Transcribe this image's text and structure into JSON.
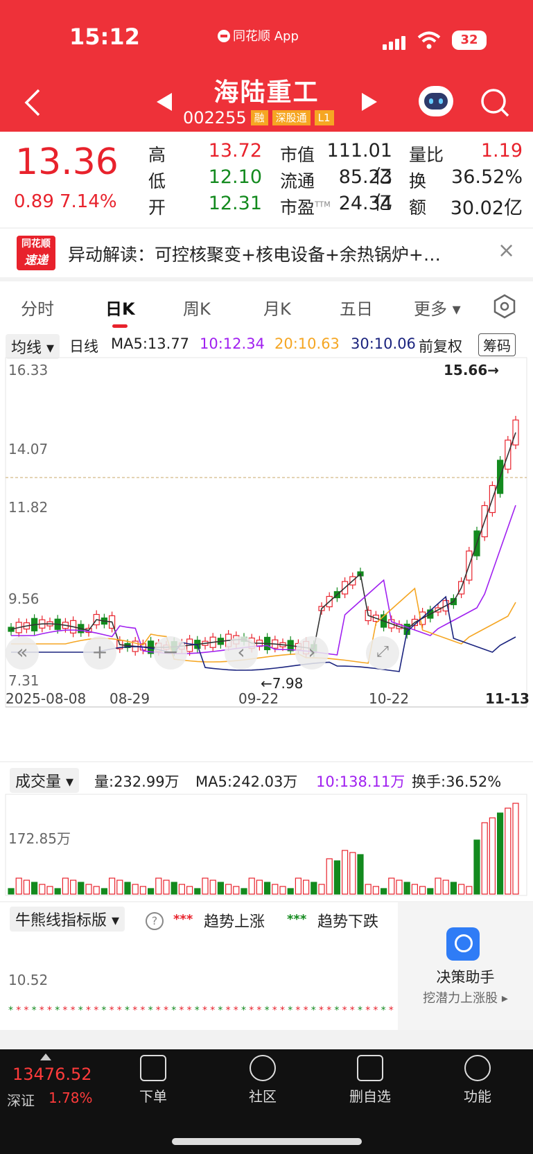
{
  "status": {
    "time": "15:12",
    "app_name": "同花顺 App",
    "battery": "32"
  },
  "header": {
    "title": "海陆重工",
    "code": "002255",
    "tags": [
      "融",
      "深股通",
      "L1"
    ]
  },
  "quote": {
    "price": "13.36",
    "change": "0.89",
    "change_pct": "7.14%",
    "high_label": "高",
    "high": "13.72",
    "low_label": "低",
    "low": "12.10",
    "open_label": "开",
    "open": "12.31",
    "mcap_label": "市值",
    "mcap": "111.01亿",
    "float_label": "流通",
    "float": "85.23亿",
    "pe_label": "市盈",
    "pe_sup": "TTM",
    "pe": "24.34",
    "vr_label": "量比",
    "vr": "1.19",
    "turn_label": "换",
    "turn": "36.52%",
    "amt_label": "额",
    "amt": "30.02亿"
  },
  "banner": {
    "logo_top": "同花顺",
    "logo_bottom": "速递",
    "text": "异动解读：可控核聚变+核电设备+余热锅炉+…"
  },
  "tabs": [
    "分时",
    "日K",
    "周K",
    "月K",
    "五日",
    "更多"
  ],
  "active_tab": "日K",
  "ma_bar": {
    "select": "均线",
    "kind": "日线",
    "ma5": "MA5:13.77",
    "ma10": "10:12.34",
    "ma20": "20:10.63",
    "ma30": "30:10.06",
    "adjust": "前复权",
    "chips": "筹码"
  },
  "colors": {
    "ma5": "#333333",
    "ma10": "#a020f0",
    "ma20": "#f5a623",
    "ma30": "#1a237e",
    "up": "#e8222c",
    "down": "#138a1e"
  },
  "price_axis": [
    "16.33",
    "14.07",
    "11.82",
    "9.56",
    "7.31"
  ],
  "annotations": {
    "high": "15.66→",
    "low": "←7.98"
  },
  "date_axis": [
    "2025-08-08",
    "08-29",
    "09-22",
    "10-22",
    "11-13"
  ],
  "volume_bar": {
    "select": "成交量",
    "vol": "量:232.99万",
    "ma5": "MA5:242.03万",
    "ma10": "10:138.11万",
    "turn": "换手:36.52%",
    "axis": "172.85万"
  },
  "bull_bar": {
    "select": "牛熊线指标版",
    "up": "趋势上涨",
    "down": "趋势下跌",
    "axis": "10.52"
  },
  "assistant": {
    "title": "决策助手",
    "sub": "挖潜力上涨股"
  },
  "bottom": {
    "index_value": "13476.52",
    "index_name": "深证",
    "index_pct": "1.78%",
    "items": [
      "下单",
      "社区",
      "删自选",
      "功能"
    ]
  }
}
